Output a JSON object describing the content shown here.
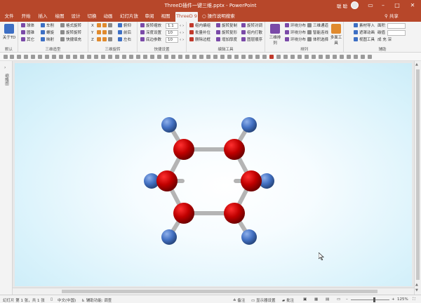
{
  "window": {
    "title": "ThreeD插件一键三维.pptx - PowerPoint",
    "user": "聪 聪",
    "accent": "#b7472a"
  },
  "tabs": [
    "文件",
    "开始",
    "插入",
    "绘图",
    "设计",
    "切换",
    "动画",
    "幻灯片放映",
    "审阅",
    "视图",
    "ThreeD 9"
  ],
  "active_tab": "ThreeD 9",
  "tell_me": "操作说明搜索",
  "share": "共享",
  "ribbon": {
    "about": {
      "label": "关于TD",
      "default": "默认"
    },
    "model_group": {
      "label": "三维造型",
      "items": [
        "球体",
        "圆锥",
        "其它",
        "车削",
        "螺旋",
        "映射",
        "格式旋转",
        "旋转旋转",
        "快捷填充"
      ]
    },
    "rotate_group": {
      "label": "三维旋转",
      "axes": [
        "X",
        "Y",
        "Z"
      ],
      "items": [
        "俯仰",
        "前后",
        "左右"
      ]
    },
    "quick_group": {
      "label": "快捷设置",
      "items": [
        "旋转缩放",
        "深度设置",
        "底边参数"
      ],
      "values": [
        "1.1",
        "10",
        "10"
      ]
    },
    "edit_group": {
      "label": "编辑工具",
      "items": [
        "组内编组",
        "批量补位",
        "删除边框",
        "旋转复制",
        "旋转复形",
        "增加厚度",
        "旋转对调",
        "组内打散",
        "图层顺序"
      ]
    },
    "array_group": {
      "label": "排列",
      "items": [
        "三维排列",
        "环绕分布",
        "环绕分布",
        "环绕分布",
        "三维通道",
        "智能连线",
        "体积选择",
        "多面工具"
      ]
    },
    "assist_group": {
      "label": "辅助",
      "items": [
        "素材导入",
        "遮罩动画",
        "视图工具"
      ],
      "fields": [
        "面积",
        "碳值"
      ],
      "misc": "成 充 深"
    }
  },
  "left_pane": {
    "label": "缩略图"
  },
  "status": {
    "slide": "幻灯片 第 1 张，共 1 张",
    "language": "中文(中国)",
    "accessibility": "辅助功能: 调查",
    "notes": "备注",
    "display": "显示器设置",
    "comments": "批注",
    "zoom": "125%"
  },
  "molecule": {
    "carbon_color": "#c00000",
    "hydrogen_color": "#4472c4",
    "bond_color": "#b4b4b4"
  }
}
